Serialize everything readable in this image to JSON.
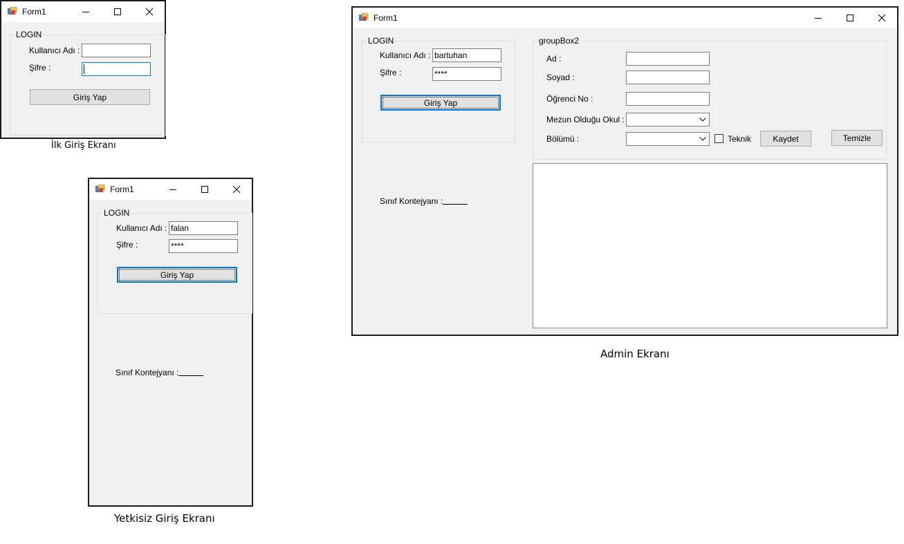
{
  "win1": {
    "title": "Form1",
    "groupbox_title": "LOGIN",
    "username_label": "Kullanıcı Adı :",
    "username_value": "",
    "password_label": "Şifre :",
    "password_value": "",
    "login_button": "Giriş Yap"
  },
  "win1_caption": "İlk Giriş Ekranı",
  "win2": {
    "title": "Form1",
    "groupbox_title": "LOGIN",
    "username_label": "Kullanıcı Adı :",
    "username_value": "falan",
    "password_label": "Şifre :",
    "password_value": "****",
    "login_button": "Giriş Yap",
    "container_label": "Sınıf Kontejyanı :"
  },
  "win2_caption": "Yetkisiz Giriş Ekranı",
  "win3": {
    "title": "Form1",
    "login": {
      "groupbox_title": "LOGIN",
      "username_label": "Kullanıcı Adı :",
      "username_value": "bartuhan",
      "password_label": "Şifre :",
      "password_value": "****",
      "login_button": "Giriş Yap"
    },
    "container_label": "Sınıf Kontejyanı :",
    "student": {
      "groupbox_title": "groupBox2",
      "name_label": "Ad :",
      "surname_label": "Soyad :",
      "student_no_label": "Öğrenci No :",
      "school_label": "Mezun Olduğu Okul :",
      "department_label": "Bölümü :",
      "technical_label": "Teknik",
      "technical_checked": false,
      "save_button": "Kaydet",
      "clear_button": "Temizle"
    }
  },
  "win3_caption": "Admin Ekranı"
}
